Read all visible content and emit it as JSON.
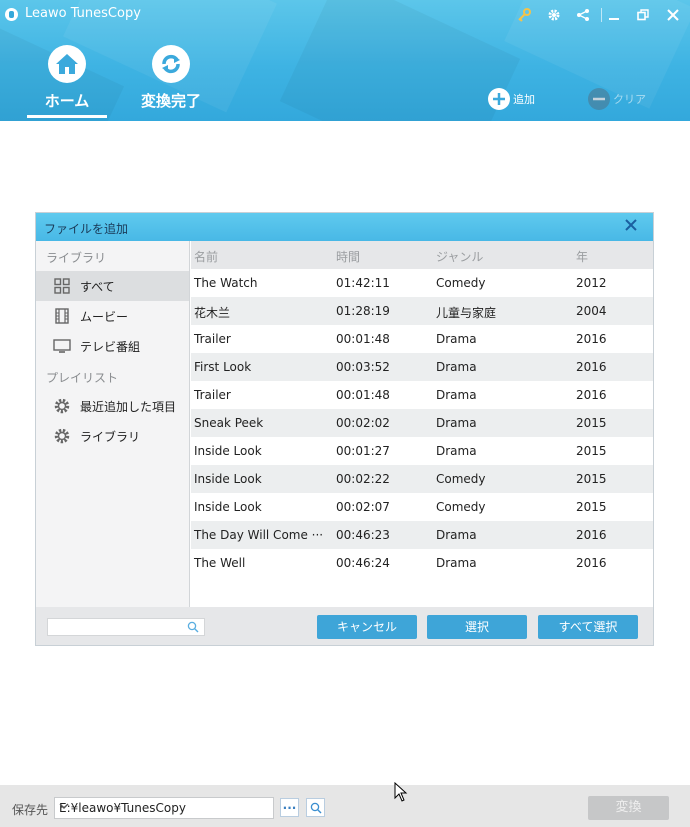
{
  "app": {
    "title": "Leawo TunesCopy"
  },
  "nav": {
    "tabs": [
      {
        "label": "ホーム",
        "icon": "home-icon",
        "active": true
      },
      {
        "label": "変換完了",
        "icon": "refresh-icon",
        "active": false
      }
    ],
    "add_label": "追加",
    "clear_label": "クリア"
  },
  "dialog": {
    "title": "ファイルを追加",
    "sidebar": {
      "library_heading": "ライブラリ",
      "library_items": [
        {
          "label": "すべて",
          "icon": "grid-icon",
          "selected": true
        },
        {
          "label": "ムービー",
          "icon": "film-icon",
          "selected": false
        },
        {
          "label": "テレビ番組",
          "icon": "tv-icon",
          "selected": false
        }
      ],
      "playlist_heading": "プレイリスト",
      "playlist_items": [
        {
          "label": "最近追加した項目",
          "icon": "gear-icon"
        },
        {
          "label": "ライブラリ",
          "icon": "gear-icon"
        }
      ]
    },
    "table": {
      "headers": [
        "名前",
        "時間",
        "ジャンル",
        "年"
      ],
      "rows": [
        {
          "name": "The Watch",
          "time": "01:42:11",
          "genre": "Comedy",
          "year": "2012"
        },
        {
          "name": "花木兰",
          "time": "01:28:19",
          "genre": "儿童与家庭",
          "year": "2004"
        },
        {
          "name": "Trailer",
          "time": "00:01:48",
          "genre": "Drama",
          "year": "2016"
        },
        {
          "name": "First Look",
          "time": "00:03:52",
          "genre": "Drama",
          "year": "2016"
        },
        {
          "name": "Trailer",
          "time": "00:01:48",
          "genre": "Drama",
          "year": "2016"
        },
        {
          "name": "Sneak Peek",
          "time": "00:02:02",
          "genre": "Drama",
          "year": "2015"
        },
        {
          "name": "Inside Look",
          "time": "00:01:27",
          "genre": "Drama",
          "year": "2015"
        },
        {
          "name": "Inside Look",
          "time": "00:02:22",
          "genre": "Comedy",
          "year": "2015"
        },
        {
          "name": "Inside Look",
          "time": "00:02:07",
          "genre": "Comedy",
          "year": "2015"
        },
        {
          "name": "The Day Will Come ···",
          "time": "00:46:23",
          "genre": "Drama",
          "year": "2016"
        },
        {
          "name": "The Well",
          "time": "00:46:24",
          "genre": "Drama",
          "year": "2016"
        }
      ]
    },
    "search": {
      "placeholder": "",
      "value": ""
    },
    "buttons": {
      "cancel": "キャンセル",
      "select": "選択",
      "select_all": "すべて選択"
    }
  },
  "footer": {
    "save_label": "保存先",
    "path": "E:¥leawo¥TunesCopy",
    "more_label": "···",
    "convert_label": "変換"
  },
  "colors": {
    "accent": "#3ea5d8",
    "header": "#3eb3e3",
    "disabled": "#c6c7c8"
  }
}
